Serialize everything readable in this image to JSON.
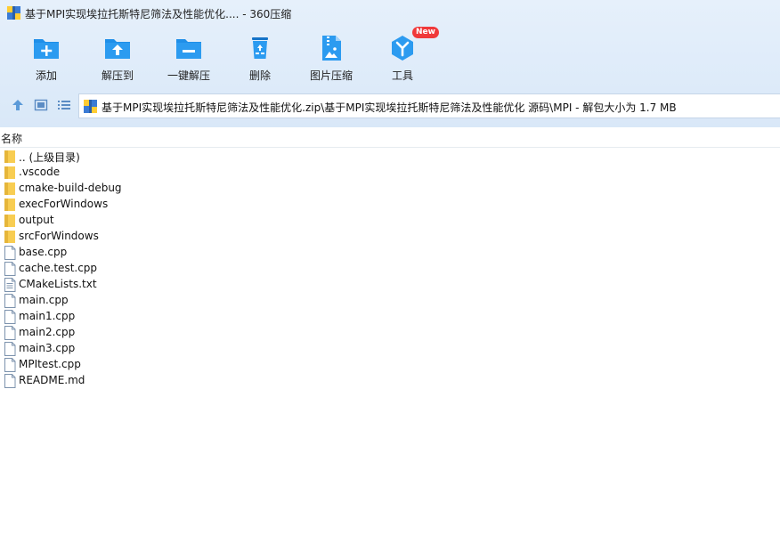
{
  "window": {
    "title": "基于MPI实现埃拉托斯特尼筛法及性能优化.... - 360压缩"
  },
  "toolbar": {
    "buttons": [
      {
        "label": "添加",
        "icon": "add-folder-icon"
      },
      {
        "label": "解压到",
        "icon": "extract-to-icon"
      },
      {
        "label": "一键解压",
        "icon": "one-click-extract-icon"
      },
      {
        "label": "删除",
        "icon": "recycle-bin-icon"
      },
      {
        "label": "图片压缩",
        "icon": "image-compress-icon"
      },
      {
        "label": "工具",
        "icon": "tools-icon",
        "badge": "New"
      }
    ]
  },
  "addressbar": {
    "path": "基于MPI实现埃拉托斯特尼筛法及性能优化.zip\\基于MPI实现埃拉托斯特尼筛法及性能优化 源码\\MPI - 解包大小为 1.7 MB"
  },
  "list": {
    "column_name": "名称",
    "items": [
      {
        "name": ".. (上级目录)",
        "type": "folder"
      },
      {
        "name": ".vscode",
        "type": "folder"
      },
      {
        "name": "cmake-build-debug",
        "type": "folder"
      },
      {
        "name": "execForWindows",
        "type": "folder"
      },
      {
        "name": "output",
        "type": "folder"
      },
      {
        "name": "srcForWindows",
        "type": "folder"
      },
      {
        "name": "base.cpp",
        "type": "file"
      },
      {
        "name": "cache.test.cpp",
        "type": "file"
      },
      {
        "name": "CMakeLists.txt",
        "type": "text"
      },
      {
        "name": "main.cpp",
        "type": "file"
      },
      {
        "name": "main1.cpp",
        "type": "file"
      },
      {
        "name": "main2.cpp",
        "type": "file"
      },
      {
        "name": "main3.cpp",
        "type": "file"
      },
      {
        "name": "MPItest.cpp",
        "type": "file"
      },
      {
        "name": "README.md",
        "type": "file"
      }
    ]
  },
  "colors": {
    "accent": "#1f8fe8",
    "accent_dark": "#1573c7",
    "folder": "#f8cd52",
    "badge": "#f0393a"
  }
}
